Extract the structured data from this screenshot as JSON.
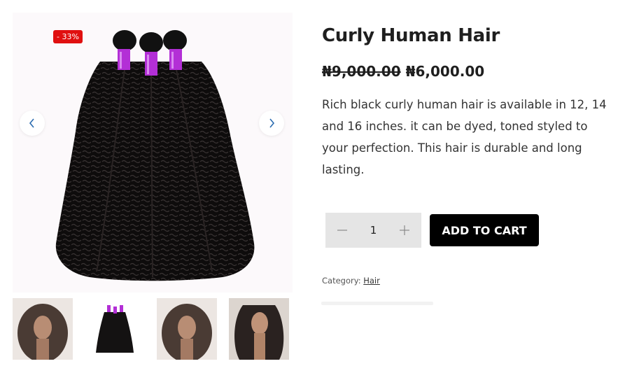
{
  "product": {
    "sale_badge": "- 33%",
    "title": "Curly Human Hair",
    "price_old": "₦9,000.00",
    "price_new": "₦6,000.00",
    "description": "Rich black curly human hair is available in 12, 14 and 16 inches. it can be dyed, toned styled to your perfection. This hair is durable and long lasting.",
    "quantity": "1",
    "add_to_cart_label": "ADD TO CART",
    "category_label": "Category:",
    "category_value": "Hair"
  },
  "gallery": {
    "prev_icon": "chevron-left-icon",
    "next_icon": "chevron-right-icon",
    "thumbnails": [
      "thumbnail-model-curly",
      "thumbnail-bundles",
      "thumbnail-model-curly",
      "thumbnail-model-wavy"
    ]
  },
  "colors": {
    "sale_badge": "#e01010",
    "add_to_cart_bg": "#000000",
    "qty_bg": "#e5e5e5",
    "hair_band": "#b32fd6"
  }
}
